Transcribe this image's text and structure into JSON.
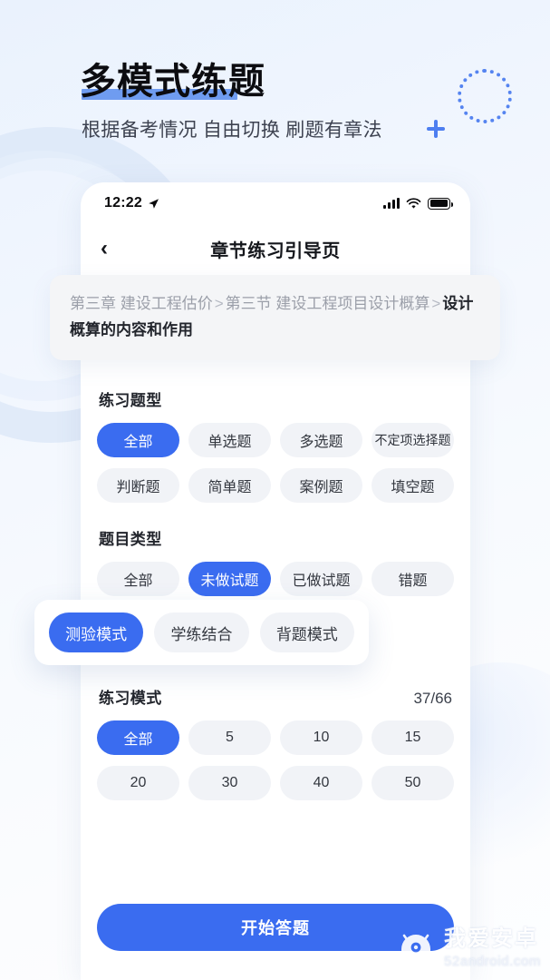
{
  "hero": {
    "title": "多模式练题",
    "subtitle": "根据备考情况 自由切换 刷题有章法"
  },
  "phone": {
    "status_bar": {
      "time": "12:22",
      "location_icon": "location-arrow-icon",
      "signal_icon": "signal-bars-icon",
      "wifi_icon": "wifi-icon",
      "battery_icon": "battery-full-icon"
    },
    "nav": {
      "back_icon": "chevron-left-icon",
      "title": "章节练习引导页"
    },
    "breadcrumb": {
      "chapter": "第三章 建设工程估价",
      "sep1": ">",
      "section": "第三节 建设工程项目设计概算",
      "sep2": ">",
      "current": "设计概算的内容和作用"
    },
    "question_type": {
      "title": "练习题型",
      "options": [
        {
          "label": "全部",
          "selected": true
        },
        {
          "label": "单选题",
          "selected": false
        },
        {
          "label": "多选题",
          "selected": false
        },
        {
          "label": "不定项选择题",
          "selected": false
        },
        {
          "label": "判断题",
          "selected": false
        },
        {
          "label": "简单题",
          "selected": false
        },
        {
          "label": "案例题",
          "selected": false
        },
        {
          "label": "填空题",
          "selected": false
        }
      ]
    },
    "item_category": {
      "title": "题目类型",
      "options": [
        {
          "label": "全部",
          "selected": false
        },
        {
          "label": "未做试题",
          "selected": true
        },
        {
          "label": "已做试题",
          "selected": false
        },
        {
          "label": "错题",
          "selected": false
        }
      ]
    },
    "mode_card": {
      "options": [
        {
          "label": "测验模式",
          "selected": true
        },
        {
          "label": "学练结合",
          "selected": false
        },
        {
          "label": "背题模式",
          "selected": false
        }
      ]
    },
    "practice_mode": {
      "title": "练习模式",
      "count": "37/66",
      "options": [
        {
          "label": "全部",
          "selected": true
        },
        {
          "label": "5",
          "selected": false
        },
        {
          "label": "10",
          "selected": false
        },
        {
          "label": "15",
          "selected": false
        },
        {
          "label": "20",
          "selected": false
        },
        {
          "label": "30",
          "selected": false
        },
        {
          "label": "40",
          "selected": false
        },
        {
          "label": "50",
          "selected": false
        }
      ]
    },
    "cta": {
      "label": "开始答题"
    }
  },
  "watermark": {
    "cn": "我爱安卓",
    "en": "52android.com",
    "icon": "android-robot-icon"
  },
  "colors": {
    "accent": "#3a6cf0",
    "pill_bg": "#f1f3f7",
    "underline": "#6f9cf0",
    "text_primary": "#22252c",
    "text_muted": "#9b9fa9"
  }
}
